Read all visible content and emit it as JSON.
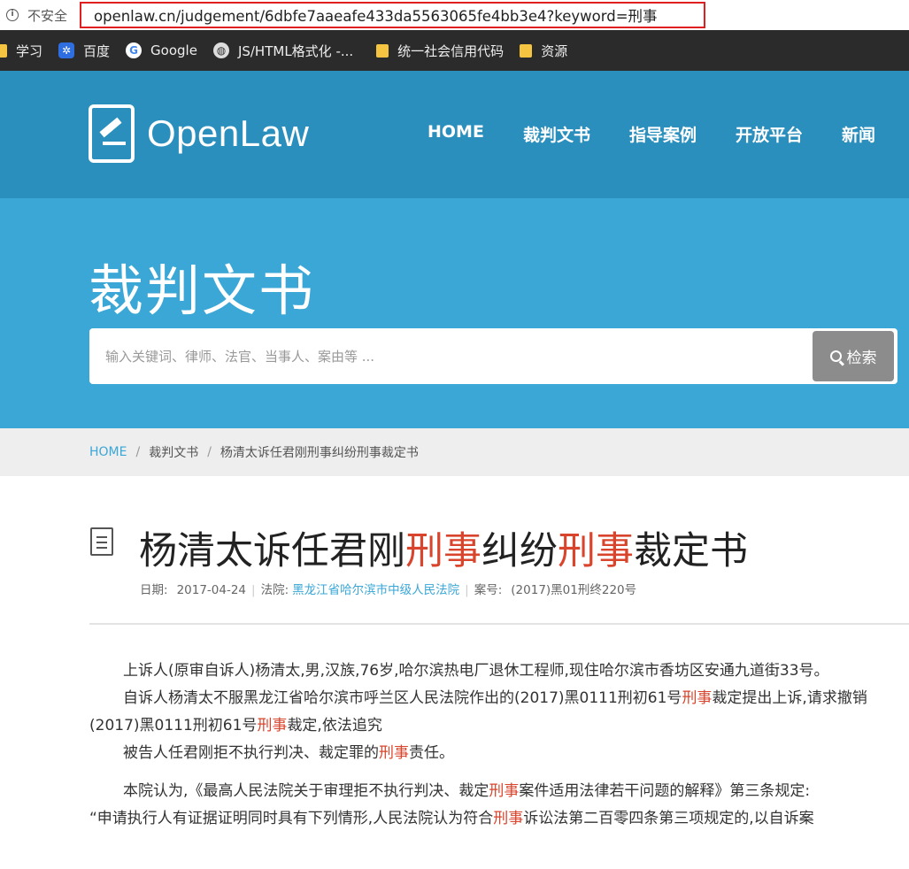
{
  "browser": {
    "security_label": "不安全",
    "url": "openlaw.cn/judgement/6dbfe7aaeafe433da5563065fe4bb3e4?keyword=刑事",
    "bookmarks": [
      {
        "icon": "folder-icon",
        "label": "学习"
      },
      {
        "icon": "baidu-icon",
        "label": "百度"
      },
      {
        "icon": "google-icon",
        "label": "Google"
      },
      {
        "icon": "globe-icon",
        "label": "JS/HTML格式化 -..."
      },
      {
        "icon": "folder-icon",
        "label": "统一社会信用代码"
      },
      {
        "icon": "folder-icon",
        "label": "资源"
      }
    ]
  },
  "header": {
    "logo_text": "OpenLaw",
    "nav": [
      "HOME",
      "裁判文书",
      "指导案例",
      "开放平台",
      "新闻"
    ]
  },
  "hero": {
    "title": "裁判文书",
    "search_placeholder": "输入关键词、律师、法官、当事人、案由等 ...",
    "search_button": "检索"
  },
  "breadcrumb": {
    "home": "HOME",
    "section": "裁判文书",
    "current": "杨清太诉任君刚刑事纠纷刑事裁定书"
  },
  "document": {
    "title_parts": [
      "杨清太诉任君刚",
      "刑事",
      "纠纷",
      "刑事",
      "裁定书"
    ],
    "meta": {
      "date_label": "日期:",
      "date": "2017-04-24",
      "court_label": "法院:",
      "court": "黑龙江省哈尔滨市中级人民法院",
      "case_label": "案号:",
      "case_no": "(2017)黑01刑终220号"
    },
    "paragraphs": {
      "p1": "上诉人(原审自诉人)杨清太,男,汉族,76岁,哈尔滨热电厂退休工程师,现住哈尔滨市香坊区安通九道街33号。",
      "p2_a": "自诉人杨清太不服黑龙江省哈尔滨市呼兰区人民法院作出的(2017)黑0111刑初61号",
      "p2_b": "刑事",
      "p2_c": "裁定提出上诉,请求撤销(2017)黑0111刑初61号",
      "p2_d": "刑事",
      "p2_e": "裁定,依法追究",
      "p3_a": "被告人任君刚拒不执行判决、裁定罪的",
      "p3_b": "刑事",
      "p3_c": "责任。",
      "p4_a": "本院认为,《最高人民法院关于审理拒不执行判决、裁定",
      "p4_b": "刑事",
      "p4_c": "案件适用法律若干问题的解释》第三条规定:",
      "p5_a": "“申请执行人有证据证明同时具有下列情形,人民法院认为符合",
      "p5_b": "刑事",
      "p5_c": "诉讼法第二百零四条第三项规定的,以自诉案"
    }
  },
  "colors": {
    "header_bg": "#2b8fbd",
    "hero_bg": "#3aa7d6",
    "highlight": "#d9452c",
    "url_box_border": "#e02020"
  }
}
